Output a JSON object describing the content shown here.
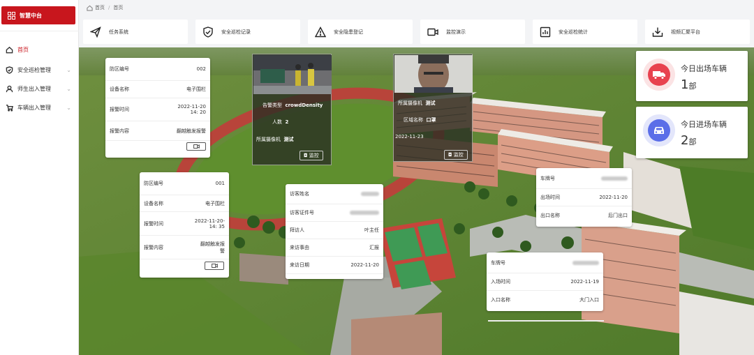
{
  "app": {
    "title": "智慧中台"
  },
  "sidebar": {
    "items": [
      {
        "label": "首页",
        "icon": "home-icon"
      },
      {
        "label": "安全巡检管理",
        "icon": "shield-icon"
      },
      {
        "label": "师生出入管理",
        "icon": "user-icon"
      },
      {
        "label": "车辆出入管理",
        "icon": "cart-icon"
      }
    ]
  },
  "breadcrumb": {
    "home": "首页",
    "separator": "/",
    "current": "首页"
  },
  "toolbar": [
    {
      "label": "任务系统",
      "icon": "send-icon"
    },
    {
      "label": "安全巡检记录",
      "icon": "shield-check-icon"
    },
    {
      "label": "安全隐患登记",
      "icon": "warning-icon"
    },
    {
      "label": "监控演示",
      "icon": "video-icon"
    },
    {
      "label": "安全巡检统计",
      "icon": "chart-icon"
    },
    {
      "label": "视频汇聚平台",
      "icon": "download-icon"
    }
  ],
  "alarm_cards": [
    {
      "rows": [
        {
          "k": "防区编号",
          "v": "002"
        },
        {
          "k": "设备名称",
          "v": "电子围栏"
        },
        {
          "k": "报警时间",
          "v": "2022-11-20\n14: 20"
        },
        {
          "k": "报警内容",
          "v": "翻越触发报警"
        }
      ]
    },
    {
      "rows": [
        {
          "k": "防区编号",
          "v": "001"
        },
        {
          "k": "设备名称",
          "v": "电子围栏"
        },
        {
          "k": "报警时间",
          "v": "2022-11-20-\n14: 35"
        },
        {
          "k": "报警内容",
          "v": "翻越触发报\n警"
        }
      ]
    }
  ],
  "camera_cards": [
    {
      "lines": [
        {
          "k": "告警类型",
          "v": "crowdDensity"
        },
        {
          "k": "人数",
          "v": "2"
        },
        {
          "k": "所属摄像机",
          "v": "测试"
        }
      ],
      "button": "监控"
    },
    {
      "lines": [
        {
          "k": "所属摄像机",
          "v": "测试"
        },
        {
          "k": "区域名称",
          "v": "口罩"
        },
        {
          "k": "",
          "v": "2022-11-23"
        }
      ],
      "button": "监控"
    }
  ],
  "visitor_card": {
    "rows": [
      {
        "k": "访客姓名",
        "v": ""
      },
      {
        "k": "访客证件号",
        "v": ""
      },
      {
        "k": "拜访人",
        "v": "叶主任"
      },
      {
        "k": "来访事由",
        "v": "汇报"
      },
      {
        "k": "来访日期",
        "v": "2022-11-20"
      }
    ]
  },
  "exit_card": {
    "rows": [
      {
        "k": "车牌号",
        "v": ""
      },
      {
        "k": "出场时间",
        "v": "2022-11-20"
      },
      {
        "k": "出口名称",
        "v": "后门出口"
      }
    ]
  },
  "entry_card": {
    "rows": [
      {
        "k": "车牌号",
        "v": ""
      },
      {
        "k": "入场时间",
        "v": "2022-11-19"
      },
      {
        "k": "入口名称",
        "v": "大门入口"
      }
    ]
  },
  "stats": [
    {
      "title": "今日出场车辆",
      "value": "1",
      "unit": "部",
      "color": "#e8424f",
      "bg": "#fbe3e4",
      "icon": "truck-icon"
    },
    {
      "title": "今日进场车辆",
      "value": "2",
      "unit": "部",
      "color": "#5b6ee8",
      "bg": "#e3e6fb",
      "icon": "car-icon"
    }
  ],
  "colors": {
    "brand": "#c8161d"
  }
}
